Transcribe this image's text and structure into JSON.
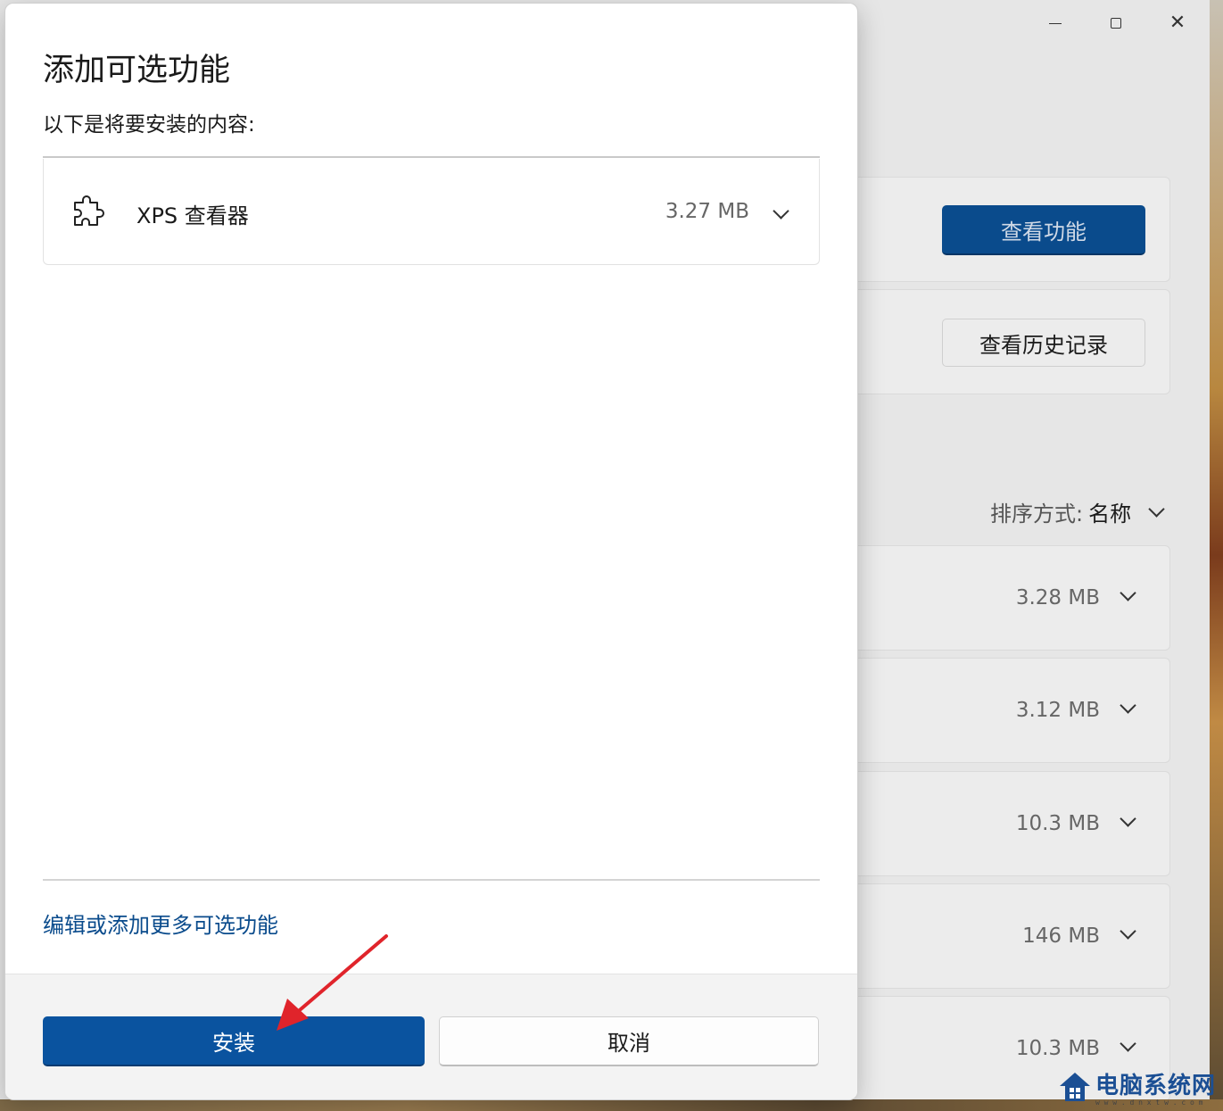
{
  "background": {
    "buttons": {
      "view_features": "查看功能",
      "view_history": "查看历史记录"
    },
    "sort": {
      "label": "排序方式:",
      "value": "名称"
    },
    "list": [
      {
        "size": "3.28 MB"
      },
      {
        "size": "3.12 MB"
      },
      {
        "size": "10.3 MB"
      },
      {
        "size": "146 MB"
      },
      {
        "size": "10.3 MB"
      }
    ]
  },
  "dialog": {
    "title": "添加可选功能",
    "subtitle": "以下是将要安装的内容:",
    "feature": {
      "name": "XPS 查看器",
      "size": "3.27 MB",
      "icon": "puzzle-icon"
    },
    "more_link": "编辑或添加更多可选功能",
    "install_label": "安装",
    "cancel_label": "取消"
  },
  "watermark": {
    "text": "电脑系统网",
    "url_text": "w w w . d n x t w . c o m"
  },
  "colors": {
    "accent": "#0a539f",
    "link": "#0a4b8c",
    "arrow": "#e0242b"
  }
}
